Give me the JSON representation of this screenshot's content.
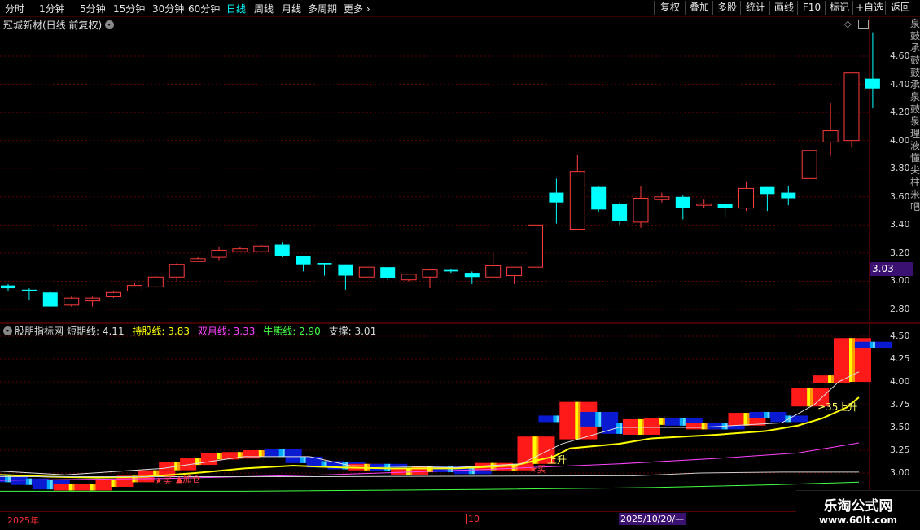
{
  "toolbar": {
    "timeframes": [
      "分时",
      "1分钟",
      "5分钟",
      "15分钟",
      "30分钟",
      "60分钟",
      "日线",
      "周线",
      "月线",
      "多周期",
      "更多"
    ],
    "active_timeframe": "日线",
    "right_buttons": [
      "复权",
      "叠加",
      "多股",
      "统计",
      "画线",
      "F10",
      "标记",
      "+自选",
      "返回"
    ]
  },
  "stock": {
    "title": "冠城新材(日线 前复权)"
  },
  "main_axis": {
    "labels": [
      "4.60",
      "4.40",
      "4.20",
      "4.00",
      "3.80",
      "3.60",
      "3.40",
      "3.20",
      "3.00",
      "2.80"
    ],
    "current_price": "3.03"
  },
  "indicator": {
    "name": "股朋指标网",
    "items": [
      {
        "label": "短期线: ",
        "value": "4.11",
        "color": "#dddddd"
      },
      {
        "label": "持股线: ",
        "value": "3.83",
        "color": "#ffff00"
      },
      {
        "label": "双月线: ",
        "value": "3.33",
        "color": "#ff44ff"
      },
      {
        "label": "牛熊线: ",
        "value": "2.90",
        "color": "#44ff44"
      },
      {
        "label": "支撑: ",
        "value": "3.01",
        "color": "#dddddd"
      }
    ],
    "axis_labels": [
      "4.50",
      "4.25",
      "4.00",
      "3.75",
      "3.50",
      "3.25",
      "3.00"
    ],
    "annotations": {
      "buy1": "★买",
      "add": "▲加仓",
      "rise1": "上升",
      "buy2": "★买",
      "rise2": "≥35上升"
    }
  },
  "date_axis": {
    "start": "2025年",
    "mid": "10",
    "cursor": "2025/10/20/—"
  },
  "watermark": {
    "title": "乐淘公式网",
    "url": "www.60lt.com"
  },
  "right_strip_text": "泉鼓承鼓鼓承泉鼓泉理液懂尖柱米吧",
  "colors": {
    "up": "#ff3c3c",
    "down": "#00ffff",
    "grid": "#5a0000"
  },
  "chart_data": {
    "type": "candlestick",
    "ohlc": [
      [
        2.97,
        2.98,
        2.93,
        2.95
      ],
      [
        2.94,
        2.95,
        2.87,
        2.93
      ],
      [
        2.92,
        2.93,
        2.82,
        2.82
      ],
      [
        2.83,
        2.89,
        2.82,
        2.88
      ],
      [
        2.86,
        2.89,
        2.82,
        2.88
      ],
      [
        2.89,
        2.93,
        2.88,
        2.92
      ],
      [
        2.93,
        2.99,
        2.93,
        2.97
      ],
      [
        2.96,
        3.04,
        2.95,
        3.03
      ],
      [
        3.03,
        3.13,
        3.0,
        3.12
      ],
      [
        3.14,
        3.17,
        3.14,
        3.16
      ],
      [
        3.17,
        3.24,
        3.15,
        3.22
      ],
      [
        3.21,
        3.24,
        3.21,
        3.23
      ],
      [
        3.21,
        3.26,
        3.21,
        3.25
      ],
      [
        3.26,
        3.28,
        3.17,
        3.18
      ],
      [
        3.18,
        3.18,
        3.07,
        3.12
      ],
      [
        3.13,
        3.13,
        3.04,
        3.12
      ],
      [
        3.12,
        3.12,
        2.94,
        3.04
      ],
      [
        3.03,
        3.1,
        3.03,
        3.1
      ],
      [
        3.1,
        3.1,
        3.01,
        3.02
      ],
      [
        3.01,
        3.05,
        3.0,
        3.05
      ],
      [
        3.03,
        3.09,
        2.95,
        3.08
      ],
      [
        3.08,
        3.09,
        3.06,
        3.07
      ],
      [
        3.06,
        3.07,
        2.98,
        3.03
      ],
      [
        3.03,
        3.2,
        3.02,
        3.11
      ],
      [
        3.04,
        3.1,
        2.98,
        3.1
      ],
      [
        3.1,
        3.4,
        3.1,
        3.4
      ],
      [
        3.63,
        3.73,
        3.41,
        3.56
      ],
      [
        3.37,
        3.9,
        3.37,
        3.78
      ],
      [
        3.67,
        3.68,
        3.49,
        3.51
      ],
      [
        3.55,
        3.56,
        3.4,
        3.43
      ],
      [
        3.42,
        3.68,
        3.38,
        3.59
      ],
      [
        3.58,
        3.63,
        3.56,
        3.6
      ],
      [
        3.6,
        3.61,
        3.44,
        3.52
      ],
      [
        3.54,
        3.58,
        3.52,
        3.55
      ],
      [
        3.55,
        3.56,
        3.45,
        3.52
      ],
      [
        3.52,
        3.71,
        3.5,
        3.66
      ],
      [
        3.67,
        3.67,
        3.5,
        3.62
      ],
      [
        3.63,
        3.68,
        3.54,
        3.59
      ],
      [
        3.73,
        3.93,
        3.73,
        3.93
      ],
      [
        3.99,
        4.27,
        3.89,
        4.07
      ],
      [
        4.0,
        4.48,
        3.95,
        4.48
      ],
      [
        4.44,
        4.77,
        4.23,
        4.37
      ]
    ],
    "y_range": [
      2.7,
      4.8
    ],
    "indicator_series": {
      "短期线": 4.11,
      "持股线": 3.83,
      "双月线": 3.33,
      "牛熊线": 2.9,
      "支撑": 3.01
    }
  }
}
